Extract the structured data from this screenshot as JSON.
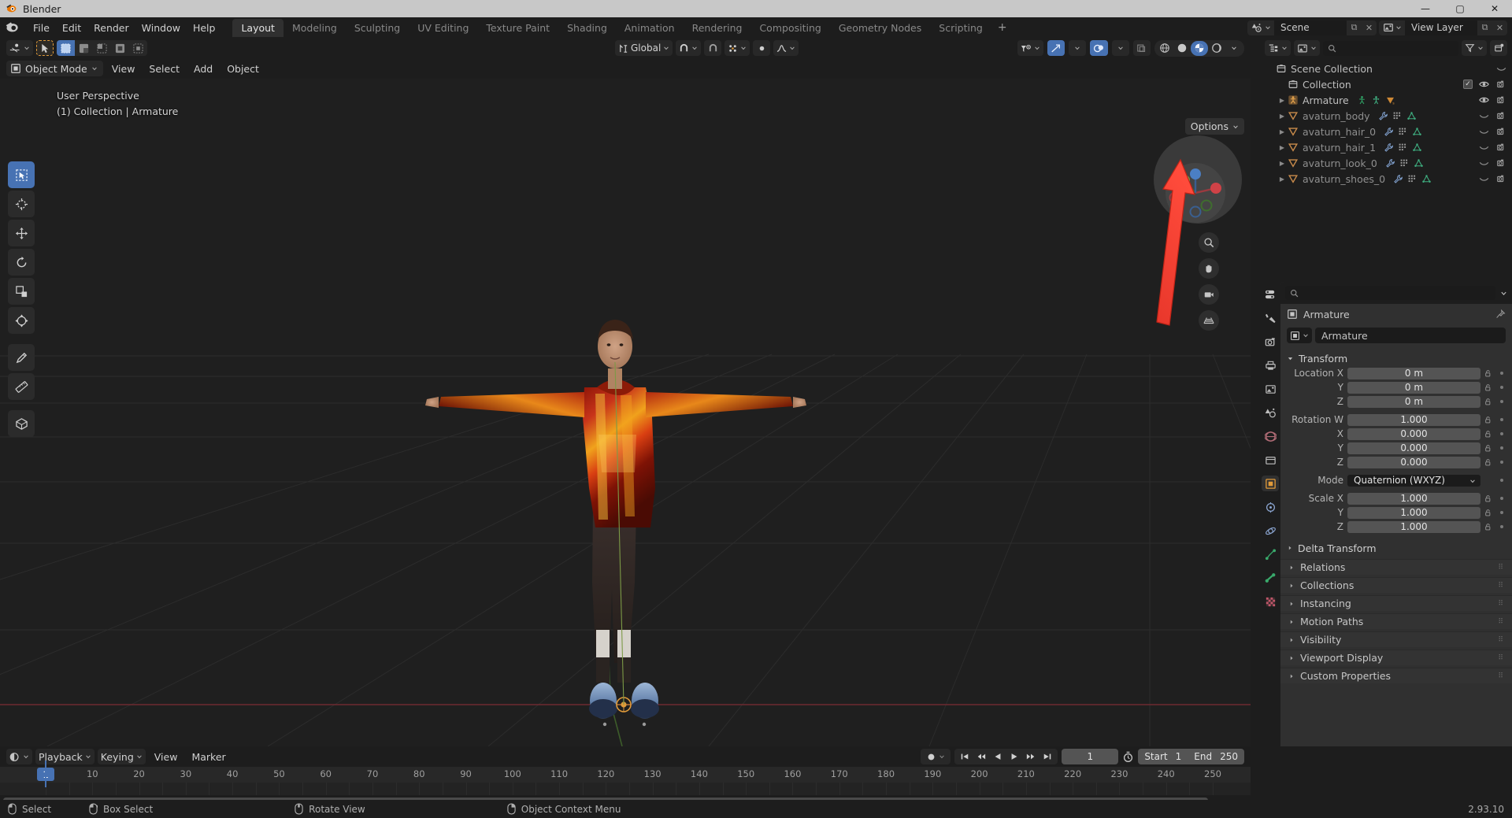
{
  "window": {
    "title": "Blender",
    "minimize": "—",
    "maximize": "▢",
    "close": "✕"
  },
  "topbar": {
    "menus": [
      "File",
      "Edit",
      "Render",
      "Window",
      "Help"
    ],
    "workspaces": [
      "Layout",
      "Modeling",
      "Sculpting",
      "UV Editing",
      "Texture Paint",
      "Shading",
      "Animation",
      "Rendering",
      "Compositing",
      "Geometry Nodes",
      "Scripting"
    ],
    "active_workspace": "Layout",
    "add_workspace": "+",
    "scene_name": "Scene",
    "view_layer_name": "View Layer",
    "copy_glyph": "⧉",
    "x_glyph": "✕"
  },
  "viewport": {
    "mode": "Object Mode",
    "menus": [
      "View",
      "Select",
      "Add",
      "Object"
    ],
    "transform_orientation": "Global",
    "options_label": "Options",
    "overlay_line1": "User Perspective",
    "overlay_line2": "(1) Collection | Armature",
    "shading_modes": [
      "wireframe",
      "solid",
      "material-preview",
      "rendered"
    ],
    "active_shading_mode": "material-preview",
    "tools": [
      "select-box-tool",
      "cursor-tool",
      "move-tool",
      "rotate-tool",
      "scale-tool",
      "transform-tool",
      "annotate-tool",
      "measure-tool",
      "add-cube-tool"
    ],
    "active_tool": "select-box-tool",
    "select_modes": [
      "set",
      "extend",
      "subtract",
      "invert",
      "intersect"
    ],
    "active_select_mode": "set"
  },
  "outliner": {
    "search_placeholder": "",
    "rows": [
      {
        "label": "Scene Collection",
        "indent": 0,
        "icon": "collection-icon",
        "disclose": "",
        "dim": false,
        "type_icons": [],
        "eye": false,
        "camera": false,
        "check": false
      },
      {
        "label": "Collection",
        "indent": 1,
        "icon": "collection-icon",
        "disclose": "",
        "dim": false,
        "type_icons": [],
        "eye": true,
        "camera": true,
        "check": true
      },
      {
        "label": "Armature",
        "indent": 1,
        "icon": "armature-icon",
        "disclose": "▶",
        "dim": false,
        "type_icons": [
          "pose-icon",
          "armature-data-icon",
          "modifier-icon"
        ],
        "eye": true,
        "camera": true,
        "check": false
      },
      {
        "label": "avaturn_body",
        "indent": 1,
        "icon": "mesh-icon",
        "disclose": "▶",
        "dim": true,
        "type_icons": [
          "wrench-icon",
          "vertex-group-icon",
          "mesh-data-icon"
        ],
        "eye": false,
        "camera": true,
        "check": false
      },
      {
        "label": "avaturn_hair_0",
        "indent": 1,
        "icon": "mesh-icon",
        "disclose": "▶",
        "dim": true,
        "type_icons": [
          "wrench-icon",
          "vertex-group-icon",
          "mesh-data-icon"
        ],
        "eye": false,
        "camera": true,
        "check": false
      },
      {
        "label": "avaturn_hair_1",
        "indent": 1,
        "icon": "mesh-icon",
        "disclose": "▶",
        "dim": true,
        "type_icons": [
          "wrench-icon",
          "vertex-group-icon",
          "mesh-data-icon"
        ],
        "eye": false,
        "camera": true,
        "check": false
      },
      {
        "label": "avaturn_look_0",
        "indent": 1,
        "icon": "mesh-icon",
        "disclose": "▶",
        "dim": true,
        "type_icons": [
          "wrench-icon",
          "vertex-group-icon",
          "mesh-data-icon"
        ],
        "eye": false,
        "camera": true,
        "check": false
      },
      {
        "label": "avaturn_shoes_0",
        "indent": 1,
        "icon": "mesh-icon",
        "disclose": "▶",
        "dim": true,
        "type_icons": [
          "wrench-icon",
          "vertex-group-icon",
          "mesh-data-icon"
        ],
        "eye": false,
        "camera": true,
        "check": false
      }
    ]
  },
  "properties": {
    "search_placeholder": "",
    "breadcrumb": "Armature",
    "object_name": "Armature",
    "transform_panel": "Transform",
    "fields": [
      {
        "label": "Location X",
        "value": "0 m",
        "lock": true
      },
      {
        "label": "Y",
        "value": "0 m",
        "lock": true
      },
      {
        "label": "Z",
        "value": "0 m",
        "lock": true
      },
      {
        "label": "Rotation W",
        "value": "1.000",
        "lock": true
      },
      {
        "label": "X",
        "value": "0.000",
        "lock": true
      },
      {
        "label": "Y",
        "value": "0.000",
        "lock": true
      },
      {
        "label": "Z",
        "value": "0.000",
        "lock": true
      }
    ],
    "mode_label": "Mode",
    "mode_value": "Quaternion (WXYZ)",
    "scale_fields": [
      {
        "label": "Scale X",
        "value": "1.000",
        "lock": true
      },
      {
        "label": "Y",
        "value": "1.000",
        "lock": true
      },
      {
        "label": "Z",
        "value": "1.000",
        "lock": true
      }
    ],
    "delta_transform": "Delta Transform",
    "panels": [
      "Relations",
      "Collections",
      "Instancing",
      "Motion Paths",
      "Visibility",
      "Viewport Display",
      "Custom Properties"
    ],
    "tabs": [
      "tool-icon",
      "render-icon",
      "output-icon",
      "view-layer-icon",
      "scene-icon",
      "world-icon",
      "collection-icon",
      "object-icon",
      "modifier-icon",
      "physics-icon",
      "constraint-icon",
      "data-icon",
      "material-icon"
    ],
    "active_tab": "object-icon"
  },
  "timeline": {
    "menus": [
      "Playback",
      "Keying",
      "View",
      "Marker"
    ],
    "current_frame": "1",
    "start_label": "Start",
    "start_value": "1",
    "end_label": "End",
    "end_value": "250",
    "ticks": [
      "1",
      "10",
      "20",
      "30",
      "40",
      "50",
      "60",
      "70",
      "80",
      "90",
      "100",
      "110",
      "120",
      "130",
      "140",
      "150",
      "160",
      "170",
      "180",
      "190",
      "200",
      "210",
      "220",
      "230",
      "240",
      "250"
    ],
    "playhead_frame": "1"
  },
  "statusbar": {
    "items": [
      {
        "label": "Select",
        "icon": "mouse-left-icon"
      },
      {
        "label": "Box Select",
        "icon": "mouse-left-drag-icon"
      },
      {
        "label": "Rotate View",
        "icon": "mouse-middle-icon"
      },
      {
        "label": "Object Context Menu",
        "icon": "mouse-right-icon"
      }
    ],
    "version": "2.93.10"
  },
  "annotation": {
    "arrow_color": "#f03a2e",
    "highlight_target": "material-preview-shading-button"
  },
  "colors": {
    "accent_blue": "#4772b3",
    "orange": "#e09a3a",
    "bg_dark": "#1d1d1d",
    "panel": "#303030",
    "viewport": "#1f1f1f"
  }
}
